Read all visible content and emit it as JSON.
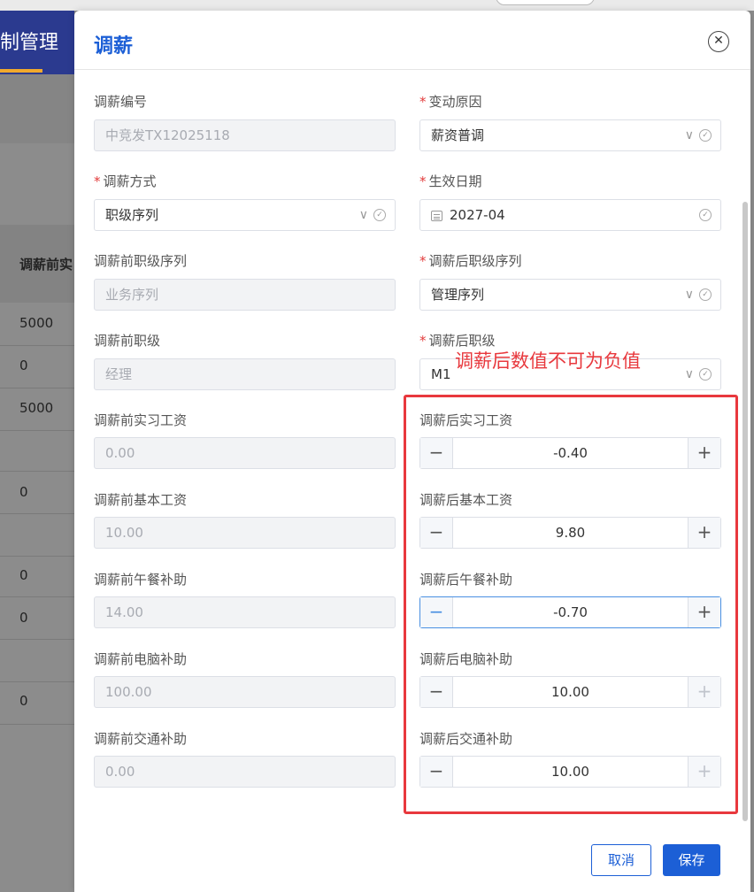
{
  "background": {
    "page_title": "制管理",
    "header": "调薪前实",
    "cells": [
      "5000",
      "0",
      "5000",
      "0",
      "0",
      "0",
      "0"
    ]
  },
  "dialog": {
    "title": "调薪",
    "close_icon": "✕",
    "left_fields": [
      {
        "label": "调薪编号",
        "required": false,
        "value": "中竞发TX12025118",
        "type": "disabled"
      },
      {
        "label": "调薪方式",
        "required": true,
        "value": "职级序列",
        "type": "select"
      },
      {
        "label": "调薪前职级序列",
        "required": false,
        "value": "业务序列",
        "type": "disabled"
      },
      {
        "label": "调薪前职级",
        "required": false,
        "value": "经理",
        "type": "disabled"
      },
      {
        "label": "调薪前实习工资",
        "required": false,
        "value": "0.00",
        "type": "disabled"
      },
      {
        "label": "调薪前基本工资",
        "required": false,
        "value": "10.00",
        "type": "disabled"
      },
      {
        "label": "调薪前午餐补助",
        "required": false,
        "value": "14.00",
        "type": "disabled"
      },
      {
        "label": "调薪前电脑补助",
        "required": false,
        "value": "100.00",
        "type": "disabled"
      },
      {
        "label": "调薪前交通补助",
        "required": false,
        "value": "0.00",
        "type": "disabled"
      }
    ],
    "right_fields": [
      {
        "label": "变动原因",
        "required": true,
        "value": "薪资普调",
        "type": "select"
      },
      {
        "label": "生效日期",
        "required": true,
        "value": "2027-04",
        "type": "date"
      },
      {
        "label": "调薪后职级序列",
        "required": true,
        "value": "管理序列",
        "type": "select"
      },
      {
        "label": "调薪后职级",
        "required": true,
        "value": "M1",
        "type": "select"
      },
      {
        "label": "调薪后实习工资",
        "required": false,
        "value": "-0.40",
        "type": "stepper"
      },
      {
        "label": "调薪后基本工资",
        "required": false,
        "value": "9.80",
        "type": "stepper"
      },
      {
        "label": "调薪后午餐补助",
        "required": false,
        "value": "-0.70",
        "type": "stepper"
      },
      {
        "label": "调薪后电脑补助",
        "required": false,
        "value": "10.00",
        "type": "stepper"
      },
      {
        "label": "调薪后交通补助",
        "required": false,
        "value": "10.00",
        "type": "stepper"
      }
    ],
    "annotation": "调薪后数值不可为负值",
    "cancel_label": "取消",
    "save_label": "保存"
  },
  "colors": {
    "accent": "#1c5fd6",
    "annotation": "#e8383d",
    "required": "#e23b3b"
  },
  "icons": {
    "minus": "−",
    "plus": "+",
    "chevron": "∨",
    "check": "✓"
  }
}
